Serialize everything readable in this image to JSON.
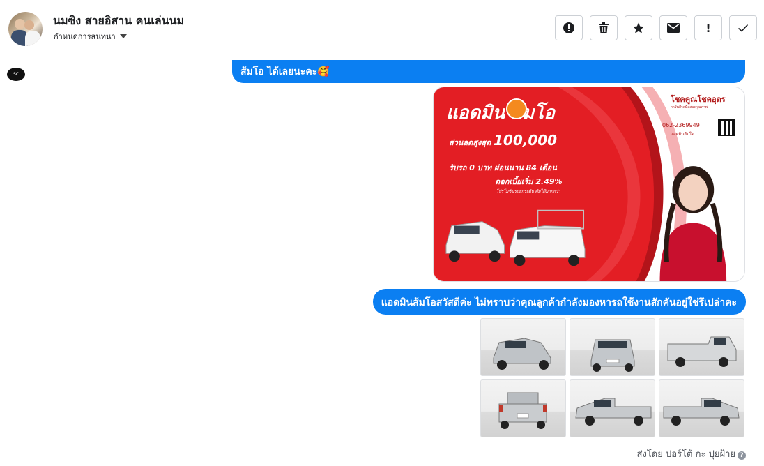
{
  "conversation": {
    "contact_name": "นมซิง สายอิสาน คนเล่นนม",
    "assign_label": "กำหนดการสนทนา"
  },
  "actions": [
    {
      "icon": "alert-circle-icon"
    },
    {
      "icon": "trash-icon"
    },
    {
      "icon": "star-icon"
    },
    {
      "icon": "envelope-icon"
    },
    {
      "icon": "exclamation-icon",
      "glyph": "!"
    },
    {
      "icon": "check-icon"
    }
  ],
  "messages": {
    "top_message_text": "ส้มโอ ได้เลยนะคะ🥰",
    "greeting_text": "แอดมินส้มโอสวัสดีค่ะ ไม่ทราบว่าคุณลูกค้ากำลังมองหารถใช้งานสักคันอยู่ใช่รึเปล่าคะ",
    "sent_by_text": "ส่งโดย ปอร์โต้ กะ ปุยฝ้าย"
  },
  "promo_image": {
    "title": "แอดมิน ส้มโอ",
    "discount_label": "ส่วนลดสูงสุด",
    "discount_value": "100,000",
    "down_payment": "รับรถ 0 บาท ผ่อนนาน 84 เดือน",
    "interest": "ดอกเบี้ยเริ่ม 2.49%",
    "fine_print": "โปรโมชั่นรถยกระดับ คุ้มได้มากกว่า",
    "brand": "โชคคูณโชคอุดร",
    "brand_sub": "การันตีรถมือสองคุณภาพ",
    "phone": "062-2369949",
    "phone_sub": "แอดมินส้มโอ",
    "accent_color": "#e31e24"
  },
  "photo_grid": {
    "count": 6
  }
}
